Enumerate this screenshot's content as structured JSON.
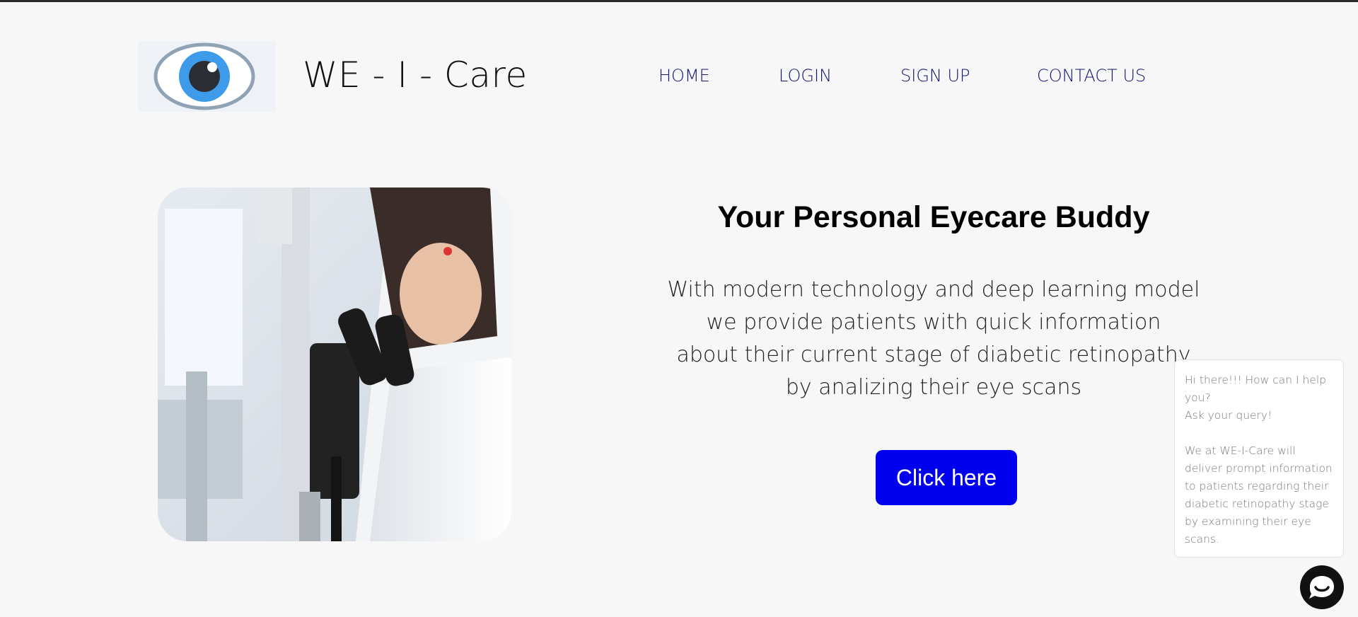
{
  "brand": {
    "name": "WE - I - Care",
    "logo_icon": "eye-icon"
  },
  "nav": {
    "items": [
      "HOME",
      "LOGIN",
      "SIGN UP",
      "CONTACT US"
    ]
  },
  "hero": {
    "image_alt": "doctor-using-slit-lamp-microscope",
    "title": "Your Personal Eyecare Buddy",
    "description_lines": [
      "With modern technology and deep learning model",
      "we provide patients with quick information",
      "about their current stage of diabetic retinopathy",
      "by analizing their eye scans"
    ],
    "cta_label": "Click here"
  },
  "chat": {
    "greeting_lines": [
      "Hi there!!! How can I help you?",
      "Ask your query!"
    ],
    "message": "We at WE-I-Care will deliver prompt information to patients regarding their diabetic retinopathy stage by examining their eye scans.",
    "toggle_icon": "chat-bubble-icon"
  },
  "colors": {
    "nav_text": "#141473",
    "cta_bg": "#0000ee",
    "eye_iris": "#3d9be9",
    "background": "#f7f7f7"
  }
}
